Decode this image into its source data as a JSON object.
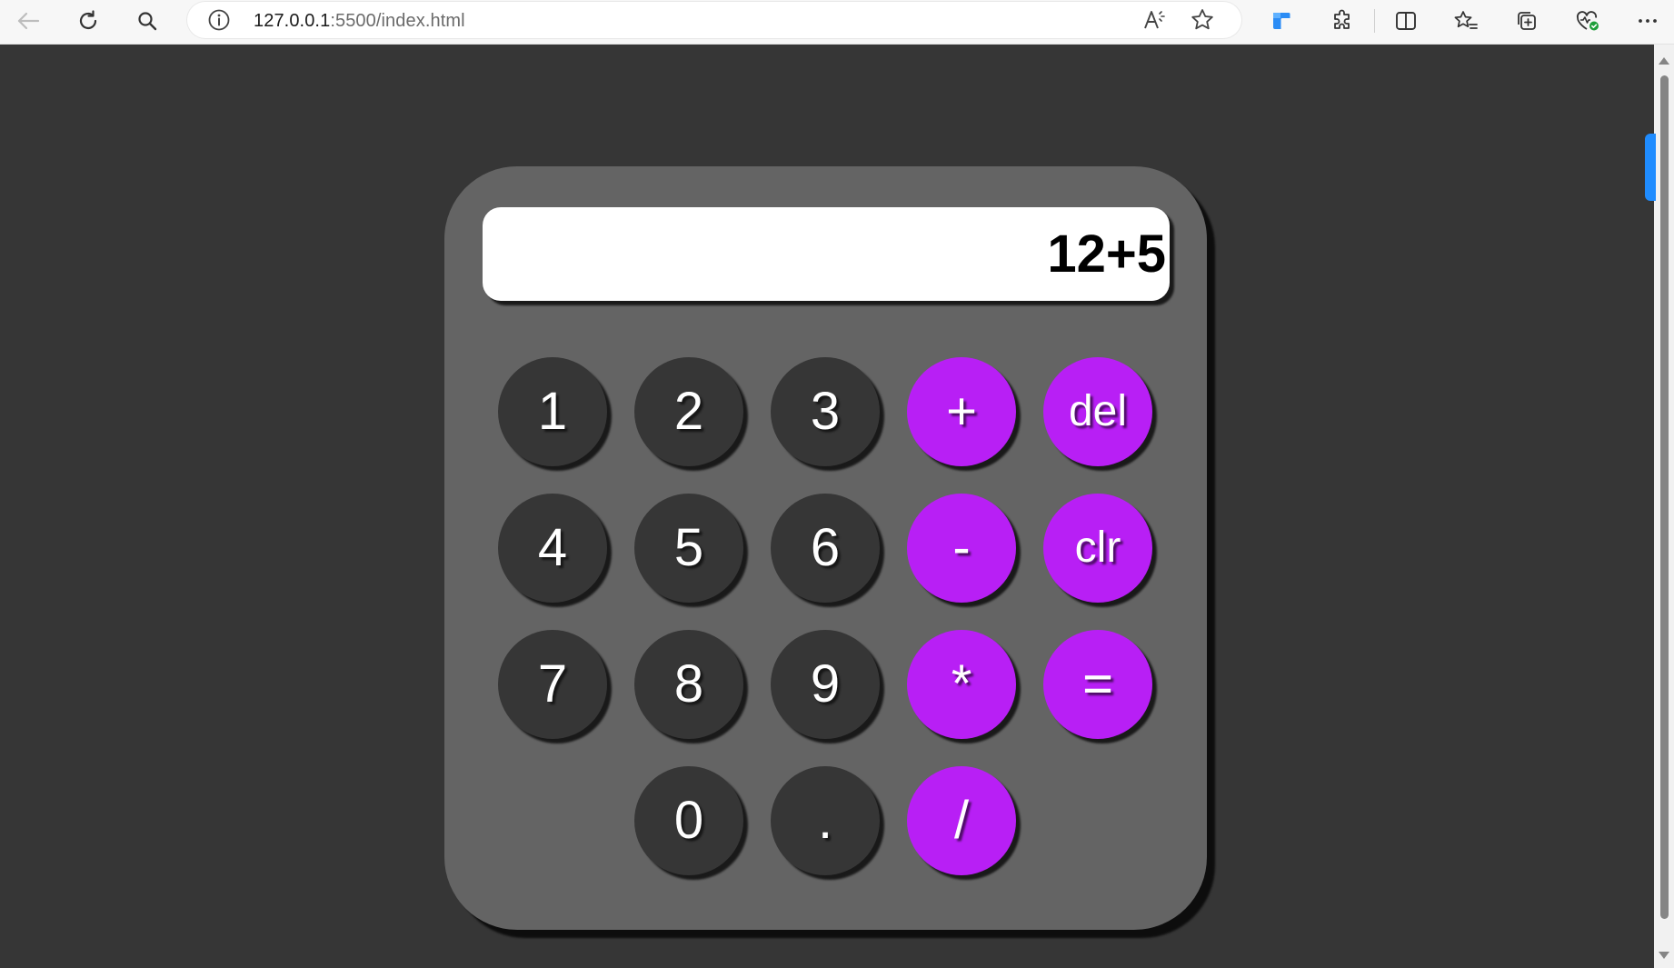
{
  "browser": {
    "url_host": "127.0.0.1",
    "url_path": ":5500/index.html",
    "icons": {
      "back": "back-arrow-icon",
      "refresh": "refresh-icon",
      "search": "search-icon",
      "site_info": "info-icon",
      "read_aloud": "read-aloud-icon",
      "favorite": "star-icon",
      "extension": "extension-puzzle-icon",
      "split_screen": "split-screen-icon",
      "favorites": "favorites-icon",
      "collections": "collections-icon",
      "health": "browser-essentials-icon",
      "more": "more-icon"
    }
  },
  "calculator": {
    "display_value": "12+5",
    "colors": {
      "page_background": "#363636",
      "body": "#646464",
      "number_key": "#363636",
      "operator_key": "#b81ff5",
      "display": "#ffffff"
    },
    "keys": {
      "one": "1",
      "two": "2",
      "three": "3",
      "plus": "+",
      "del": "del",
      "four": "4",
      "five": "5",
      "six": "6",
      "minus": "-",
      "clr": "clr",
      "seven": "7",
      "eight": "8",
      "nine": "9",
      "multiply": "*",
      "equals": "=",
      "zero": "0",
      "dot": ".",
      "divide": "/"
    }
  }
}
